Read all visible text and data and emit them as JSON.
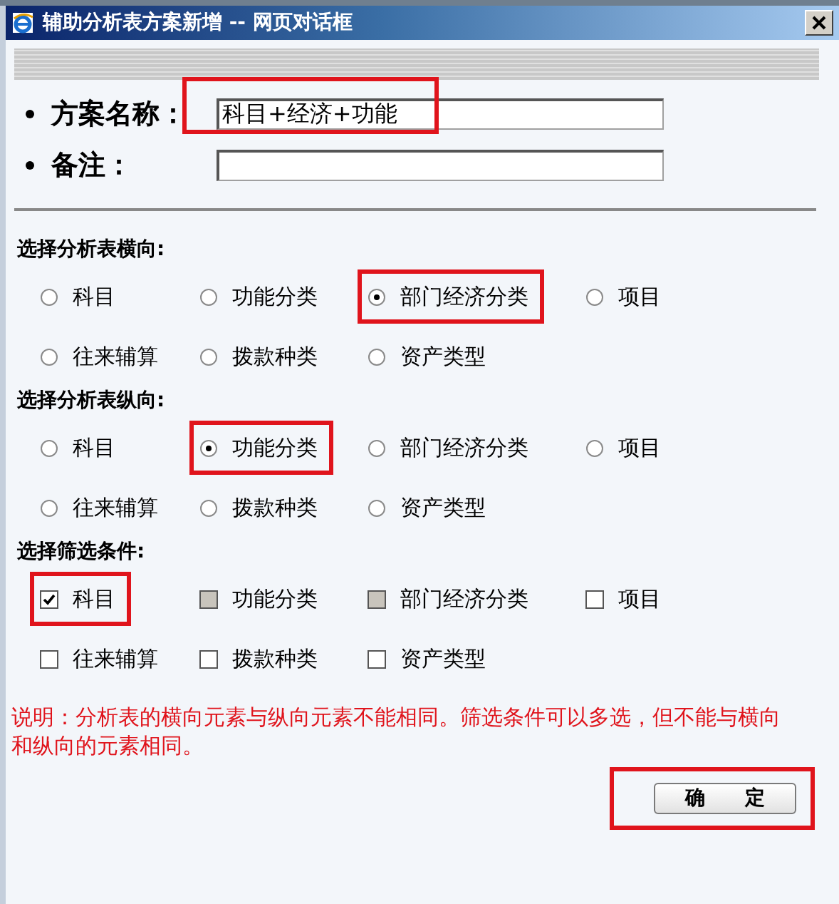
{
  "window": {
    "title": "辅助分析表方案新增 -- 网页对话框"
  },
  "fields": [
    {
      "label": "方案名称：",
      "value": "科目+经济+功能",
      "highlighted": true
    },
    {
      "label": "备注：",
      "highlighted": false
    }
  ],
  "sections": [
    {
      "heading": "选择分析表横向:",
      "kind": "radio",
      "options": [
        {
          "label": "科目",
          "selected": false,
          "highlighted": false
        },
        {
          "label": "功能分类",
          "selected": false,
          "highlighted": false
        },
        {
          "label": "部门经济分类",
          "selected": true,
          "highlighted": true
        },
        {
          "label": "项目",
          "selected": false,
          "highlighted": false
        },
        {
          "label": "往来辅算",
          "selected": false,
          "highlighted": false
        },
        {
          "label": "拨款种类",
          "selected": false,
          "highlighted": false
        },
        {
          "label": "资产类型",
          "selected": false,
          "highlighted": false
        }
      ]
    },
    {
      "heading": "选择分析表纵向:",
      "kind": "radio",
      "options": [
        {
          "label": "科目",
          "selected": false,
          "highlighted": false
        },
        {
          "label": "功能分类",
          "selected": true,
          "highlighted": true
        },
        {
          "label": "部门经济分类",
          "selected": false,
          "highlighted": false
        },
        {
          "label": "项目",
          "selected": false,
          "highlighted": false
        },
        {
          "label": "往来辅算",
          "selected": false,
          "highlighted": false
        },
        {
          "label": "拨款种类",
          "selected": false,
          "highlighted": false
        },
        {
          "label": "资产类型",
          "selected": false,
          "highlighted": false
        }
      ]
    },
    {
      "heading": "选择筛选条件:",
      "kind": "checkbox",
      "options": [
        {
          "label": "科目",
          "checked": true,
          "disabled": false,
          "highlighted": true
        },
        {
          "label": "功能分类",
          "checked": false,
          "disabled": true,
          "highlighted": false
        },
        {
          "label": "部门经济分类",
          "checked": false,
          "disabled": true,
          "highlighted": false
        },
        {
          "label": "项目",
          "checked": false,
          "disabled": false,
          "highlighted": false
        },
        {
          "label": "往来辅算",
          "checked": false,
          "disabled": false,
          "highlighted": false
        },
        {
          "label": "拨款种类",
          "checked": false,
          "disabled": false,
          "highlighted": false
        },
        {
          "label": "资产类型",
          "checked": false,
          "disabled": false,
          "highlighted": false
        }
      ]
    }
  ],
  "note": "说明：分析表的横向元素与纵向元素不能相同。筛选条件可以多选，但不能与横向和纵向的元素相同。",
  "confirm_button": {
    "label": "确　　定",
    "highlighted": true
  }
}
